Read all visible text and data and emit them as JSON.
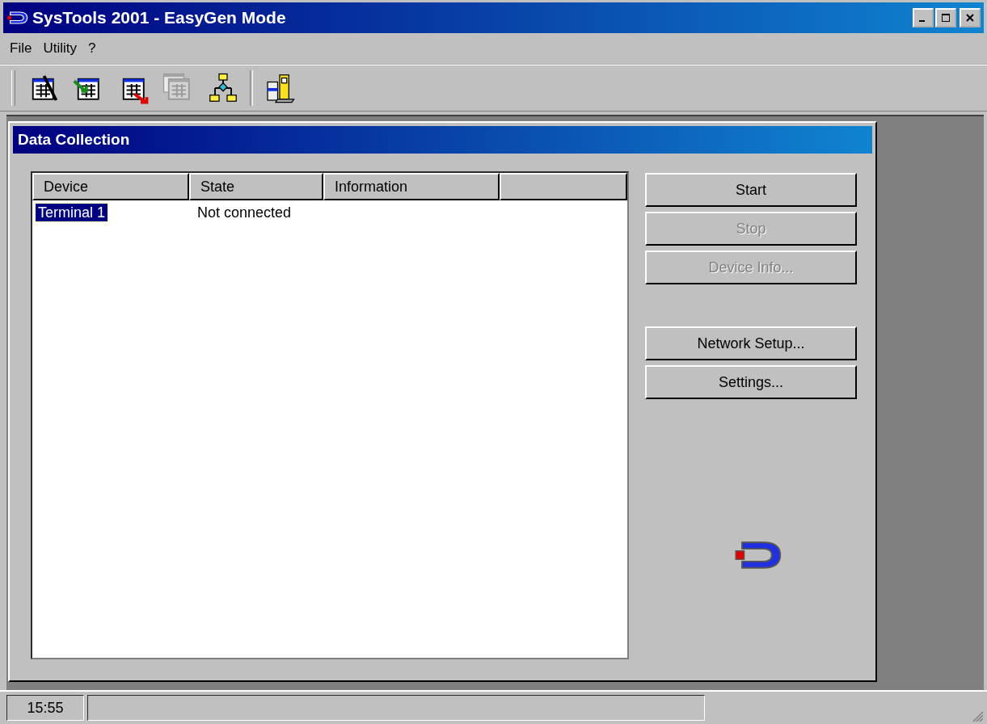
{
  "window": {
    "title": "SysTools 2001 - EasyGen Mode"
  },
  "menu": [
    "File",
    "Utility",
    "?"
  ],
  "toolbar": [
    {
      "kind": "wand-table",
      "disabled": false
    },
    {
      "kind": "import-table",
      "disabled": false
    },
    {
      "kind": "export-table",
      "disabled": false
    },
    {
      "kind": "windows",
      "disabled": true
    },
    {
      "kind": "hierarchy",
      "disabled": false
    },
    {
      "kind": "device",
      "disabled": false
    }
  ],
  "child_window": {
    "title": "Data Collection"
  },
  "table": {
    "columns": [
      "Device",
      "State",
      "Information"
    ],
    "rows": [
      {
        "device": "Terminal 1",
        "state": "Not connected",
        "selected": true
      }
    ]
  },
  "buttons_top": [
    {
      "label": "Start",
      "disabled": false
    },
    {
      "label": "Stop",
      "disabled": true
    },
    {
      "label": "Device Info...",
      "disabled": true
    }
  ],
  "buttons_bottom": [
    {
      "label": "Network Setup...",
      "disabled": false
    },
    {
      "label": "Settings...",
      "disabled": false
    }
  ],
  "status_bar": {
    "time": "15:55"
  }
}
